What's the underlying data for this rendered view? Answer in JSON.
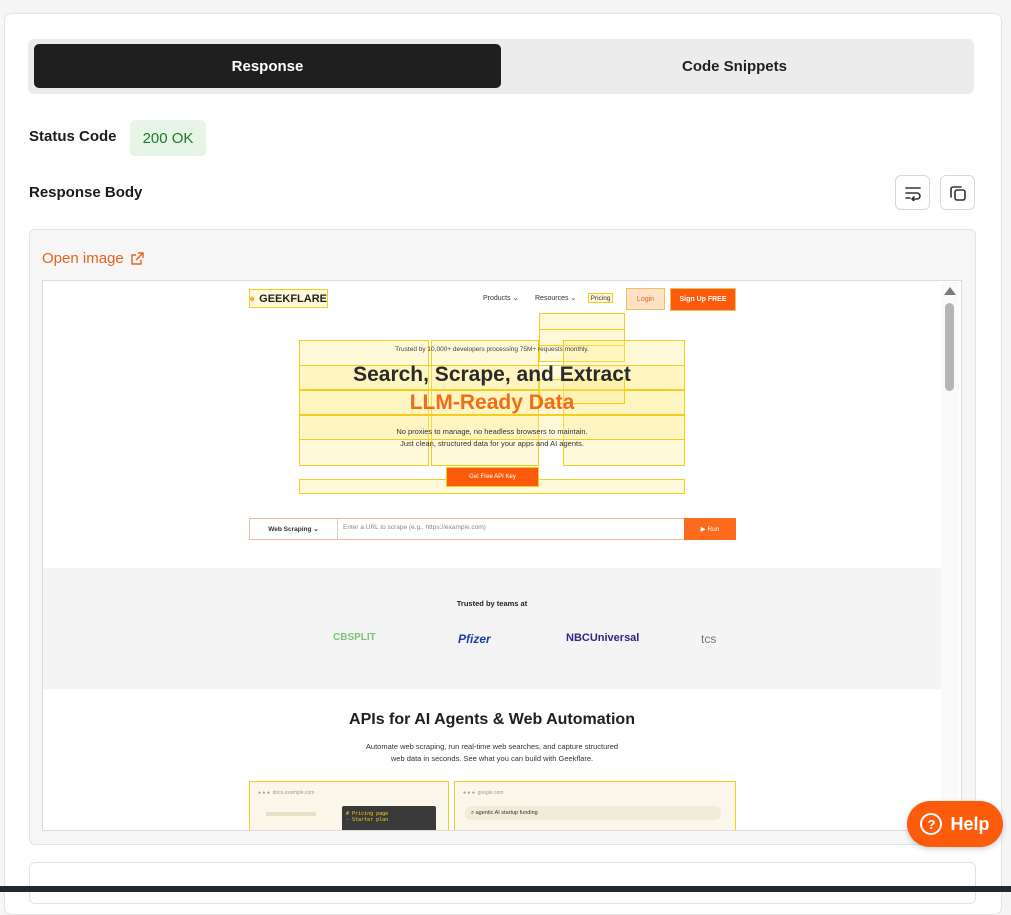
{
  "tabs": {
    "response": "Response",
    "code_snippets": "Code Snippets"
  },
  "status": {
    "label": "Status Code",
    "value": "200 OK"
  },
  "response_body": {
    "label": "Response Body",
    "wrap_icon": "wrap-lines-icon",
    "copy_icon": "copy-icon"
  },
  "open_image": {
    "label": "Open image",
    "icon": "external-link-icon"
  },
  "preview": {
    "logo": "GEEKFLARE",
    "nav": {
      "products": "Products",
      "resources": "Resources",
      "pricing": "Pricing",
      "login": "Login",
      "signup": "Sign Up FREE"
    },
    "trusted_line": "Trusted by 10,000+ developers processing 75M+ requests monthly.",
    "headline_1": "Search, Scrape, and Extract",
    "headline_2": "LLM-Ready Data",
    "sub_1": "No proxies to manage, no headless browsers to maintain.",
    "sub_2": "Just clean, structured data for your apps and AI agents.",
    "cta": "Get Free API Key",
    "select_label": "Web Scraping",
    "url_placeholder": "Enter a URL to scrape (e.g., https://example.com)",
    "run": "Run",
    "trusted_teams": "Trusted by teams at",
    "logos": [
      "CBSPLIT",
      "Pfizer",
      "NBCUniversal",
      "tcs"
    ],
    "apis_title": "APIs for AI Agents & Web Automation",
    "apis_sub_1": "Automate web scraping, run real-time web searches, and capture structured",
    "apis_sub_2": "web data in seconds. See what you can build with Geekflare.",
    "card1_url": "docs.example.com",
    "card1_code_1": "# Pricing page",
    "card1_code_2": "- Starter plan",
    "card2_url": "google.com",
    "card2_query": "agentic AI startup funding"
  },
  "help": {
    "label": "Help",
    "icon": "question-circle-icon"
  },
  "colors": {
    "accent": "#fb5b0b",
    "dark": "#1f1f1f",
    "success_bg": "#e6f5e6",
    "success_text": "#1f7a2e"
  }
}
